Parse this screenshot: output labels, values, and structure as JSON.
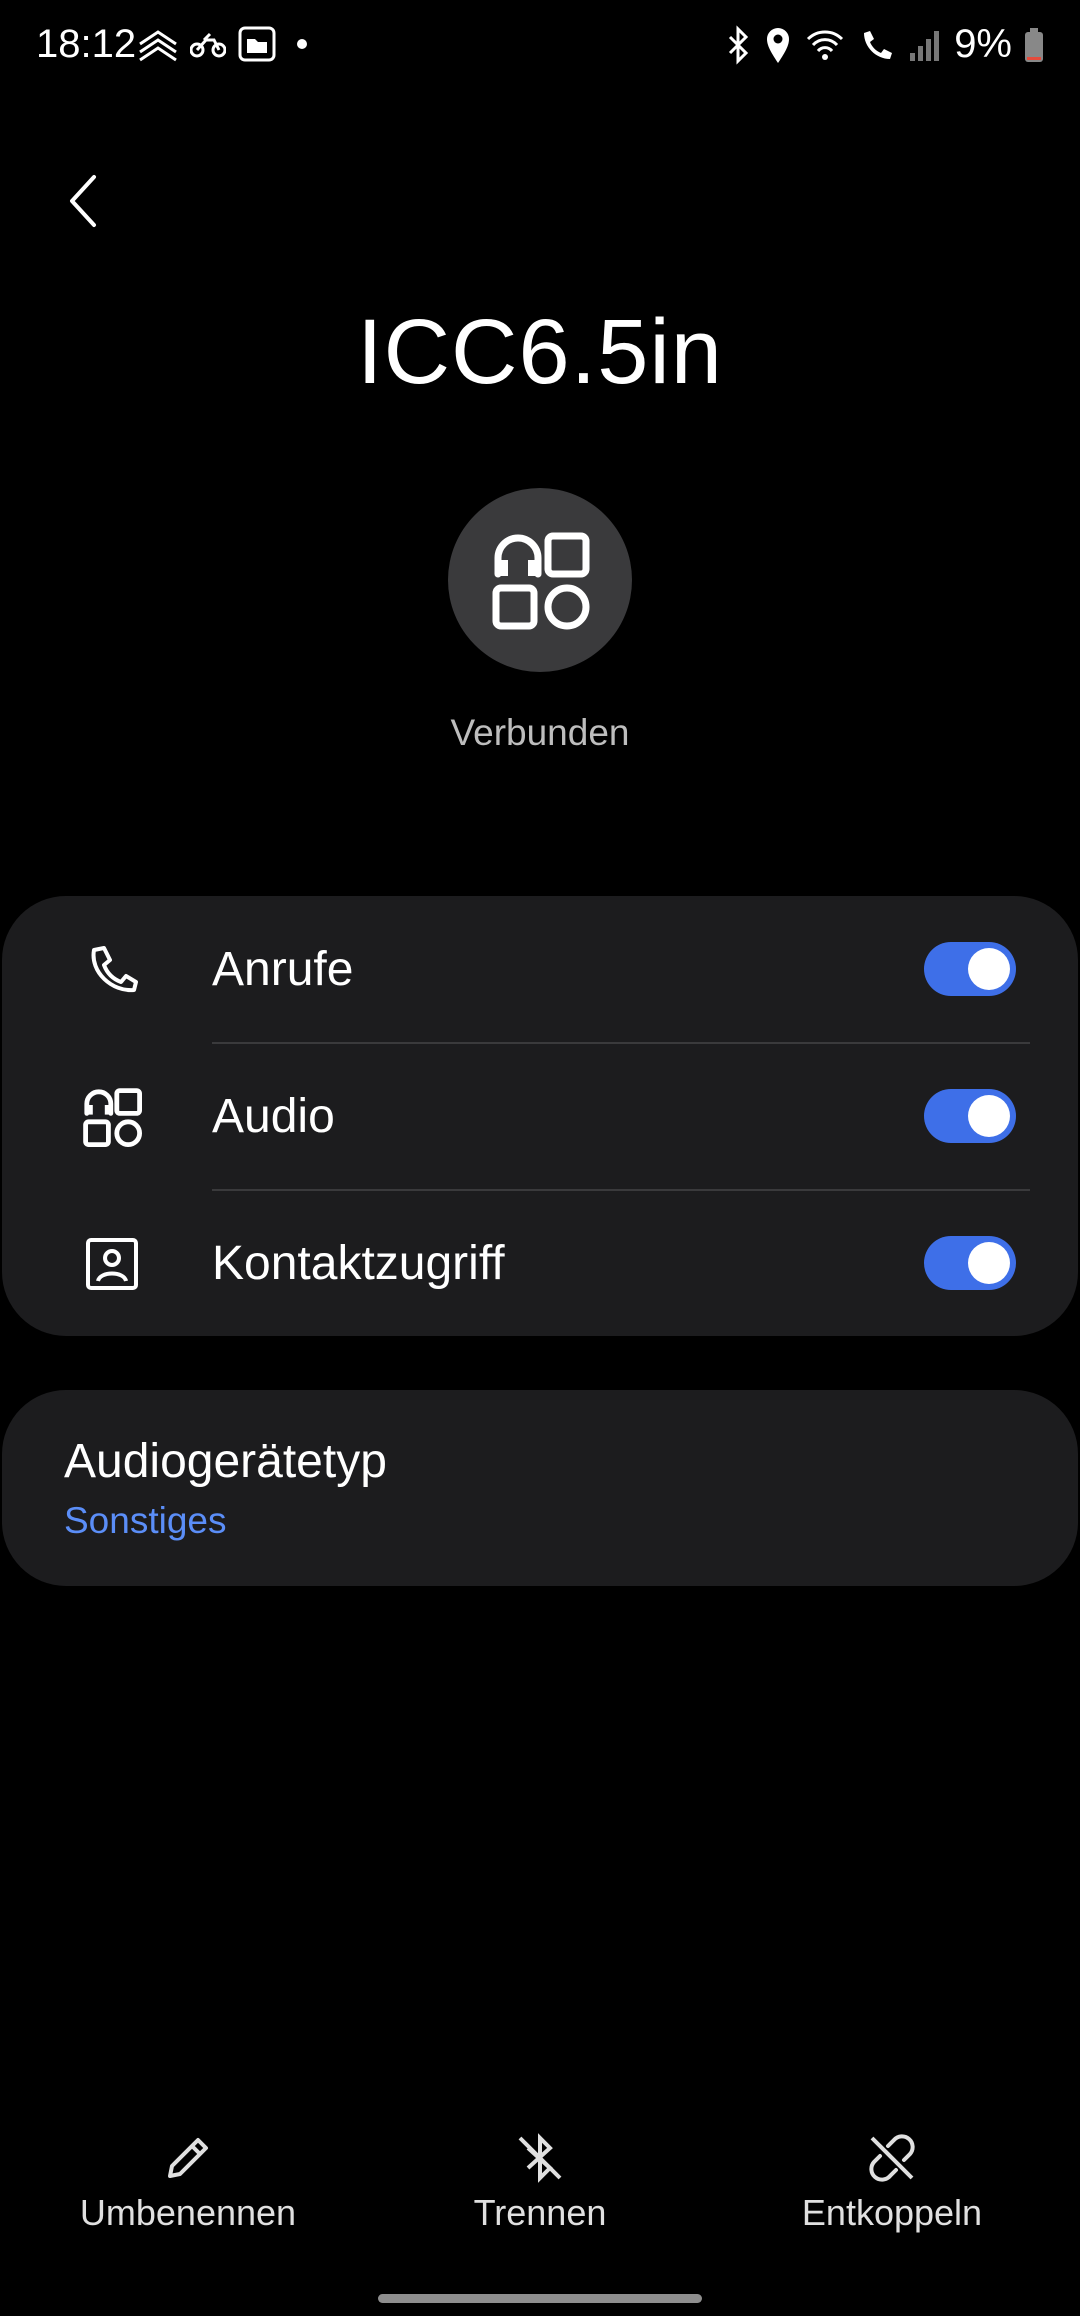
{
  "status_bar": {
    "time": "18:12",
    "battery": "9%",
    "left_icons": [
      "chevrons-icon",
      "motorbike-icon",
      "folder-icon",
      "dot-icon"
    ],
    "right_icons": [
      "bluetooth-icon",
      "location-icon",
      "wifi-calling-icon",
      "phone-wifi-icon",
      "signal-icon",
      "battery-icon"
    ]
  },
  "header": {
    "device_name": "ICC6.5in",
    "status": "Verbunden"
  },
  "profiles": [
    {
      "label": "Anrufe",
      "icon": "phone-icon",
      "enabled": true
    },
    {
      "label": "Audio",
      "icon": "audio-device-icon",
      "enabled": true
    },
    {
      "label": "Kontaktzugriff",
      "icon": "contact-icon",
      "enabled": true
    }
  ],
  "audio_type": {
    "title": "Audiogerätetyp",
    "value": "Sonstiges"
  },
  "actions": {
    "rename": "Umbenennen",
    "disconnect": "Trennen",
    "unpair": "Entkoppeln"
  },
  "colors": {
    "accent": "#3e6fe8",
    "link": "#5b8ef8",
    "card": "#1c1c1e",
    "background": "#000000"
  }
}
